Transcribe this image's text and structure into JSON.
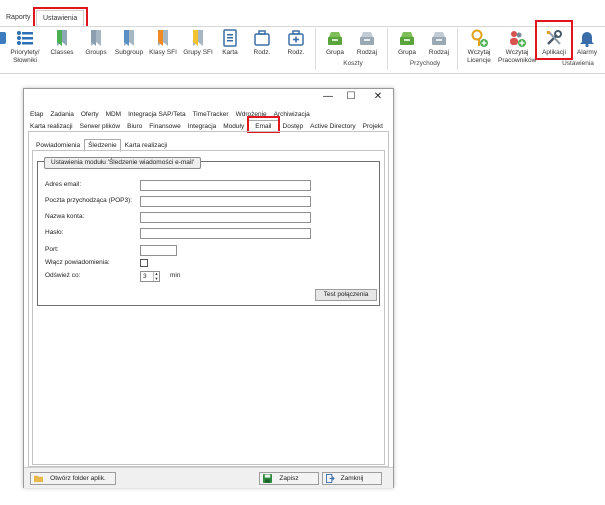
{
  "ribbon": {
    "tabs": [
      {
        "label": "Raporty"
      },
      {
        "label": "Ustawienia"
      }
    ],
    "buttons": [
      {
        "label": "Priorytety/\nSłowniki",
        "icon": "priority-list-icon"
      },
      {
        "label": "Classes",
        "icon": "bookmark-green-icon"
      },
      {
        "label": "Groups",
        "icon": "bookmark-gray-icon"
      },
      {
        "label": "Subgroup",
        "icon": "bookmark-blue-icon"
      },
      {
        "label": "Klasy SFI",
        "icon": "bookmark-orange-icon"
      },
      {
        "label": "Grupy SFI",
        "icon": "bookmark-yellow-icon"
      },
      {
        "label": "Karta",
        "icon": "card-icon"
      },
      {
        "label": "Rodz.",
        "icon": "briefcase-icon"
      },
      {
        "label": "Rodz.",
        "icon": "medical-case-icon"
      },
      {
        "label": "Grupa",
        "icon": "inbox-green-icon"
      },
      {
        "label": "Rodzaj",
        "icon": "inbox-gray-icon"
      },
      {
        "label": "Grupa",
        "icon": "inbox-green-icon"
      },
      {
        "label": "Rodzaj",
        "icon": "inbox-gray-icon"
      },
      {
        "label": "Wczytaj\nLicencje",
        "icon": "key-plus-icon"
      },
      {
        "label": "Wczytaj\nPracowników",
        "icon": "users-plus-icon"
      },
      {
        "label": "Aplikacji",
        "icon": "tools-icon"
      },
      {
        "label": "Alarmy",
        "icon": "bell-icon"
      }
    ],
    "groups": {
      "koszty": "Koszty",
      "przychody": "Przychody",
      "ustawienia": "Ustawienia"
    }
  },
  "dialog": {
    "window_controls": {
      "minimize": "—",
      "maximize": "☐",
      "close": "✕"
    },
    "tabs_row1": [
      "Etap",
      "Zadania",
      "Oferty",
      "MDM",
      "Integracja SAP/Teta",
      "TimeTracker",
      "Wdrożenie",
      "Archiwizacja"
    ],
    "tabs_row2": [
      "Karta realizacji",
      "Serwer plików",
      "Biuro",
      "Finansowe",
      "Integracja",
      "Moduły",
      "Email",
      "Dostęp",
      "Active Directory",
      "Projekt"
    ],
    "active_tab": "Email",
    "subtabs": [
      "Powiadomienia",
      "Śledzenie",
      "Karta realizacji"
    ],
    "active_subtab": "Śledzenie",
    "group_title": "Ustawienia modułu 'Śledzenie wiadomości e-mail'",
    "fields": {
      "email_label": "Adres email:",
      "pop3_label": "Poczta przychodząca (POP3):",
      "login_label": "Nazwa konta:",
      "password_label": "Hasło:",
      "port_label": "Port:",
      "notify_label": "Włącz powiadomienia:",
      "refresh_label": "Odśwież co:",
      "refresh_value": "3",
      "refresh_unit": "min"
    },
    "test_button": "Test połączenia",
    "bottom": {
      "open_folder": "Otwórz folder aplik.",
      "save": "Zapisz",
      "close": "Zamknij"
    }
  }
}
